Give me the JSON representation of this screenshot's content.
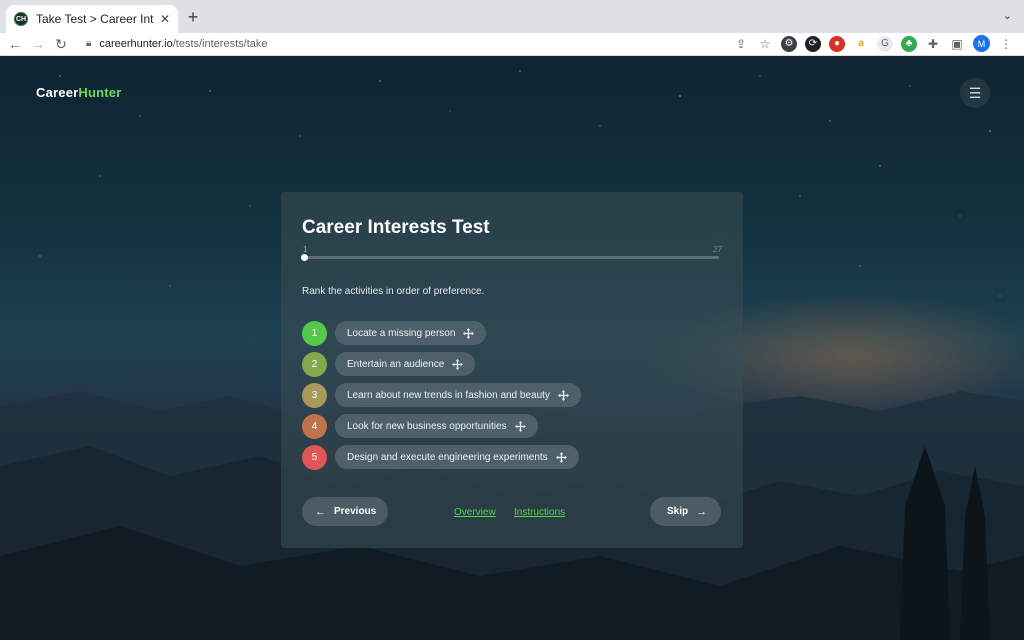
{
  "browser": {
    "tab_title": "Take Test > Career Interests",
    "tab_favicon_text": "CH",
    "url_domain": "careerhunter.io",
    "url_path": "/tests/interests/take",
    "profile_initial": "M"
  },
  "site": {
    "logo_part1": "Career",
    "logo_part2": "Hunter",
    "accent_color": "#6bdc5a"
  },
  "test": {
    "title": "Career Interests Test",
    "progress_current": "1",
    "progress_total": "27",
    "progress_fraction": 0.0,
    "instruction": "Rank the activities in order of preference.",
    "activities": [
      {
        "rank": "1",
        "label": "Locate a missing person",
        "color": "#55c94a"
      },
      {
        "rank": "2",
        "label": "Entertain an audience",
        "color": "#84a84e"
      },
      {
        "rank": "3",
        "label": "Learn about new trends in fashion and beauty",
        "color": "#a89a5a"
      },
      {
        "rank": "4",
        "label": "Look for new business opportunities",
        "color": "#c0734f"
      },
      {
        "rank": "5",
        "label": "Design and execute engineering experiments",
        "color": "#e05555"
      }
    ],
    "previous_label": "Previous",
    "skip_label": "Skip",
    "overview_link": "Overview",
    "instructions_link": "Instructions"
  }
}
